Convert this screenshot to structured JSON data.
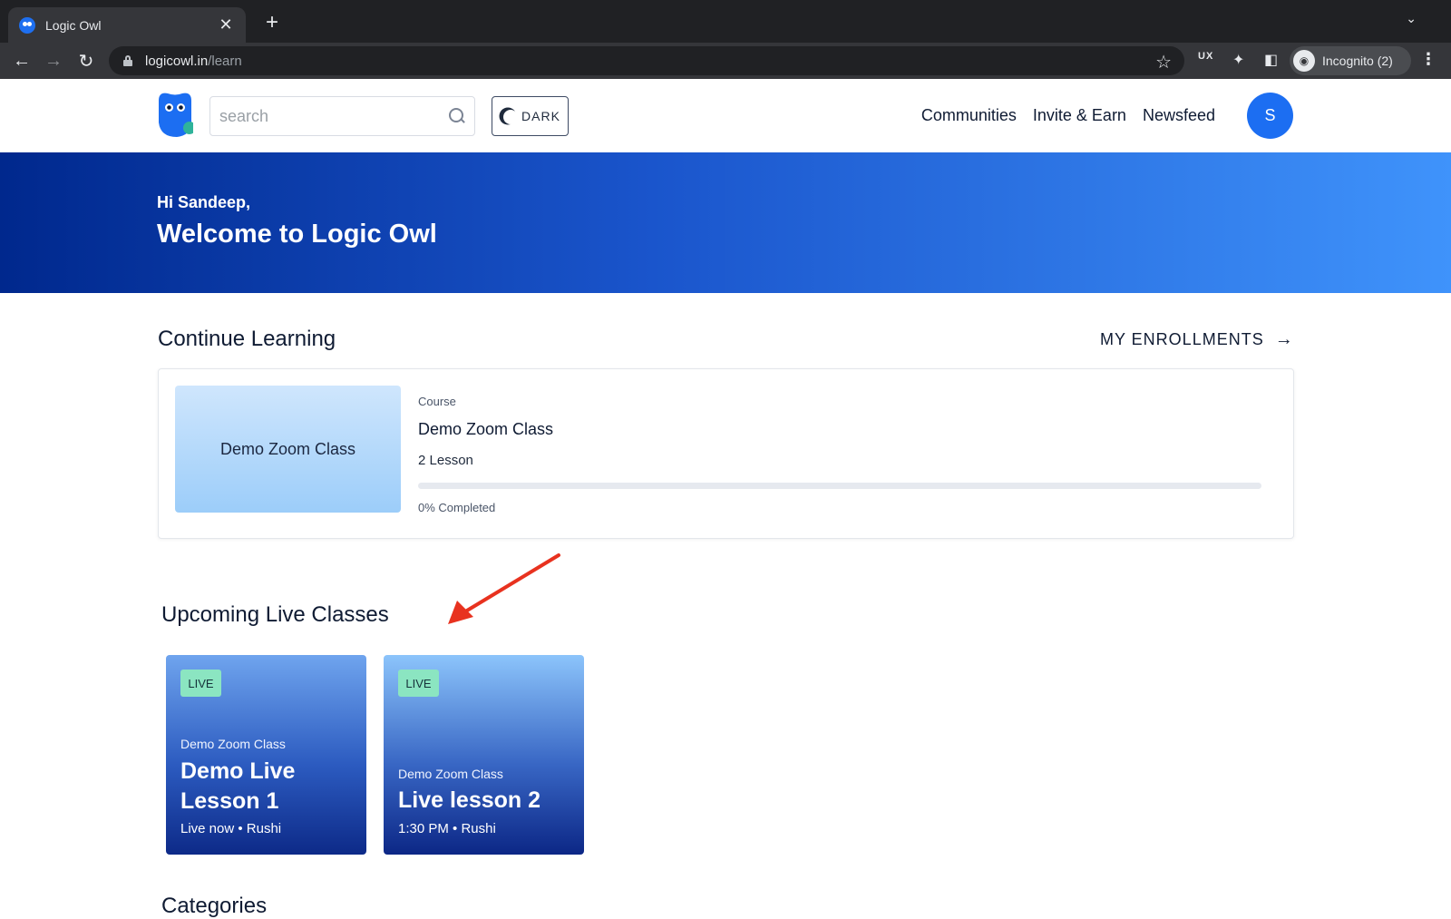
{
  "browser": {
    "tab_title": "Logic Owl",
    "url_host": "logicowl.in",
    "url_path": "/learn",
    "incognito_label": "Incognito (2)",
    "ux_label": "UX"
  },
  "header": {
    "search_placeholder": "search",
    "dark_label": "DARK",
    "nav": [
      "Communities",
      "Invite & Earn",
      "Newsfeed"
    ],
    "avatar_initial": "S",
    "brand_color": "#1c6ef2"
  },
  "hero": {
    "greeting": "Hi Sandeep,",
    "title": "Welcome to Logic Owl"
  },
  "continue_learning": {
    "title": "Continue Learning",
    "enrollments_label": "MY ENROLLMENTS",
    "course": {
      "thumb_text": "Demo Zoom Class",
      "kind": "Course",
      "name": "Demo Zoom Class",
      "lessons": "2 Lesson",
      "progress_label": "0% Completed",
      "progress_fraction": 0
    }
  },
  "live_classes": {
    "title": "Upcoming Live Classes",
    "badge_color": "#8be5c1",
    "items": [
      {
        "badge": "LIVE",
        "course": "Demo Zoom Class",
        "title": "Demo Live Lesson 1",
        "meta": "Live now • Rushi"
      },
      {
        "badge": "LIVE",
        "course": "Demo Zoom Class",
        "title": "Live lesson 2",
        "meta": "1:30 PM • Rushi"
      }
    ]
  },
  "categories_title": "Categories",
  "annotation_color": "#e8321f"
}
